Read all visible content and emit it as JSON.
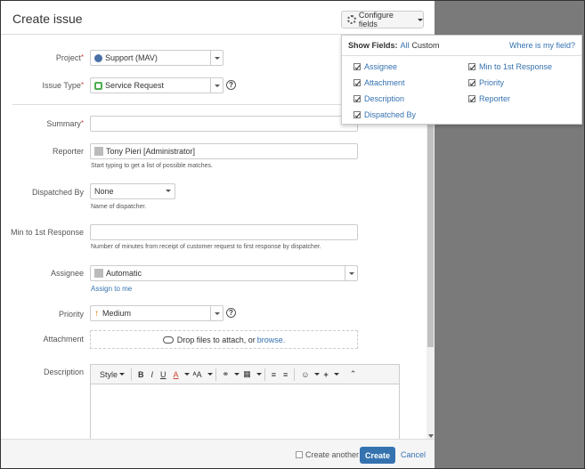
{
  "dialog": {
    "title": "Create issue",
    "configure_label": "Configure fields"
  },
  "fields": {
    "project": {
      "label": "Project",
      "value": "Support (MAV)"
    },
    "issue_type": {
      "label": "Issue Type",
      "value": "Service Request"
    },
    "summary": {
      "label": "Summary",
      "value": ""
    },
    "reporter": {
      "label": "Reporter",
      "value": "Tony Pieri  [Administrator]",
      "hint": "Start typing to get a list of possible matches."
    },
    "dispatched_by": {
      "label": "Dispatched By",
      "value": "None",
      "hint": "Name of dispatcher."
    },
    "min_first_response": {
      "label": "Min to 1st Response",
      "value": "",
      "hint": "Number of minutes from receipt of customer request to first response by dispatcher."
    },
    "assignee": {
      "label": "Assignee",
      "value": "Automatic",
      "assign_link": "Assign to me"
    },
    "priority": {
      "label": "Priority",
      "value": "Medium"
    },
    "attachment": {
      "label": "Attachment",
      "drop_text": "Drop files to attach, or ",
      "browse": "browse."
    },
    "description": {
      "label": "Description"
    }
  },
  "toolbar": {
    "style": "Style",
    "bold": "B",
    "italic": "I",
    "underline": "U",
    "color": "A",
    "size": "ᴬA"
  },
  "footer": {
    "create_another": "Create another",
    "create": "Create",
    "cancel": "Cancel"
  },
  "popup": {
    "show_fields": "Show Fields:",
    "all": "All",
    "custom": "Custom",
    "where": "Where is my field?",
    "left": [
      "Assignee",
      "Attachment",
      "Description",
      "Dispatched By"
    ],
    "right": [
      "Min to 1st Response",
      "Priority",
      "Reporter"
    ]
  },
  "icons": {
    "help": "?",
    "priority_arrow": "↑",
    "required": "*"
  }
}
